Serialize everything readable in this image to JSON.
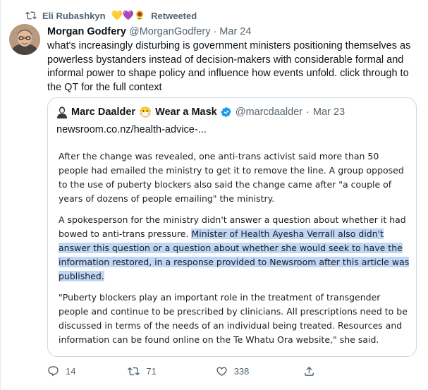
{
  "retweet": {
    "by": "Eli Rubashkyn",
    "emojis": "💛💜🌻",
    "label": "Retweeted"
  },
  "tweet": {
    "name": "Morgan Godfery",
    "handle": "@MorganGodfery",
    "separator": "·",
    "date": "Mar 24",
    "text": "what's increasingly disturbing is government ministers positioning themselves as powerless bystanders instead of decision-makers with considerable formal and informal power to shape policy and influence how events unfold. click through to the QT for the full context"
  },
  "quote": {
    "name_prefix": "Marc Daalder",
    "mask_emoji": "😷",
    "name_suffix": "Wear a Mask",
    "handle": "@marcdaalder",
    "separator": "·",
    "date": "Mar 23",
    "link": "newsroom.co.nz/health-advice-...",
    "para1": "After the change was revealed, one anti-trans activist said more than 50 people had emailed the ministry to get it to remove the line. A group opposed to the use of puberty blockers also said the change came after \"a couple of years of dozens of people emailing\" the ministry.",
    "para2_plain": "A spokesperson for the ministry didn't answer a question about whether it had bowed to anti-trans pressure. ",
    "para2_highlight": "Minister of Health Ayesha Verrall also didn't answer this question or a question about whether she would seek to have the information restored, in a response provided to Newsroom after this article was published.",
    "para3": "\"Puberty blockers play an important role in the treatment of transgender people and continue to be prescribed by clinicians. All prescriptions need to be discussed in terms of the needs of an individual being treated. Resources and information can be found online on the Te Whatu Ora website,\" she said."
  },
  "actions": {
    "replies": "14",
    "retweets": "71",
    "likes": "338"
  },
  "colors": {
    "muted": "#536471",
    "verified": "#1d9bf0",
    "highlight": "#bfd6f6",
    "border": "#cfd9de"
  }
}
